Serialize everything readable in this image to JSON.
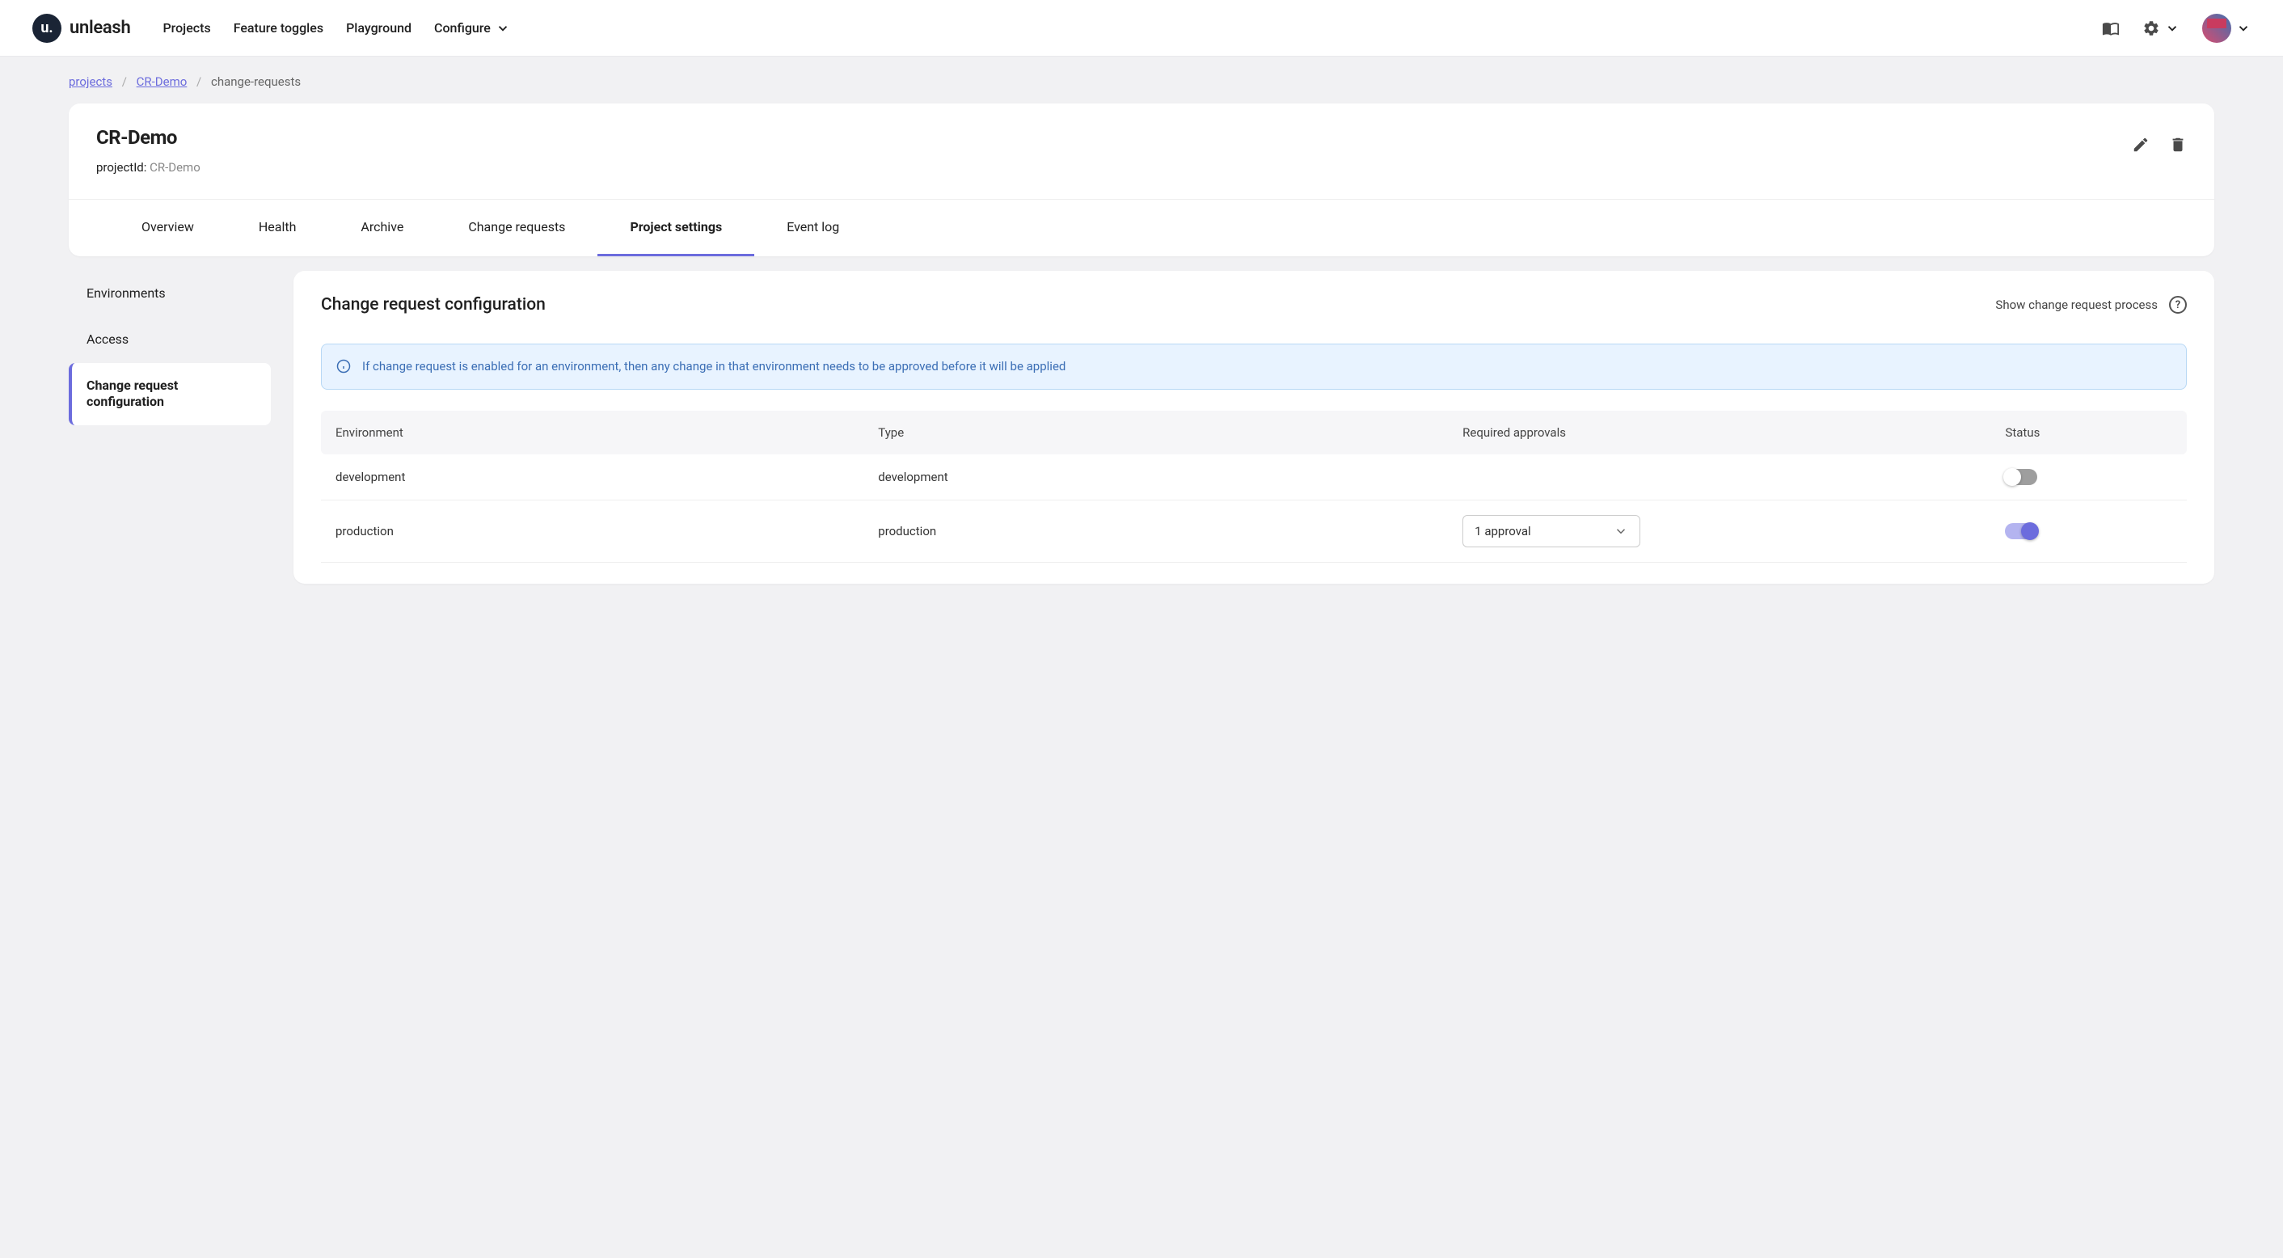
{
  "brand": "unleash",
  "nav": {
    "projects": "Projects",
    "feature_toggles": "Feature toggles",
    "playground": "Playground",
    "configure": "Configure"
  },
  "breadcrumb": {
    "projects": "projects",
    "project_name": "CR-Demo",
    "current": "change-requests"
  },
  "project": {
    "title": "CR-Demo",
    "id_label": "projectId: ",
    "id_value": "CR-Demo"
  },
  "tabs": {
    "overview": "Overview",
    "health": "Health",
    "archive": "Archive",
    "change_requests": "Change requests",
    "project_settings": "Project settings",
    "event_log": "Event log"
  },
  "sidebar": {
    "environments": "Environments",
    "access": "Access",
    "change_request_config": "Change request configuration"
  },
  "settings": {
    "title": "Change request configuration",
    "show_process": "Show change request process",
    "info": "If change request is enabled for an environment, then any change in that environment needs to be approved before it will be applied"
  },
  "table": {
    "headers": {
      "environment": "Environment",
      "type": "Type",
      "required_approvals": "Required approvals",
      "status": "Status"
    },
    "rows": [
      {
        "environment": "development",
        "type": "development",
        "approvals": "",
        "status_on": false
      },
      {
        "environment": "production",
        "type": "production",
        "approvals": "1 approval",
        "status_on": true
      }
    ]
  }
}
